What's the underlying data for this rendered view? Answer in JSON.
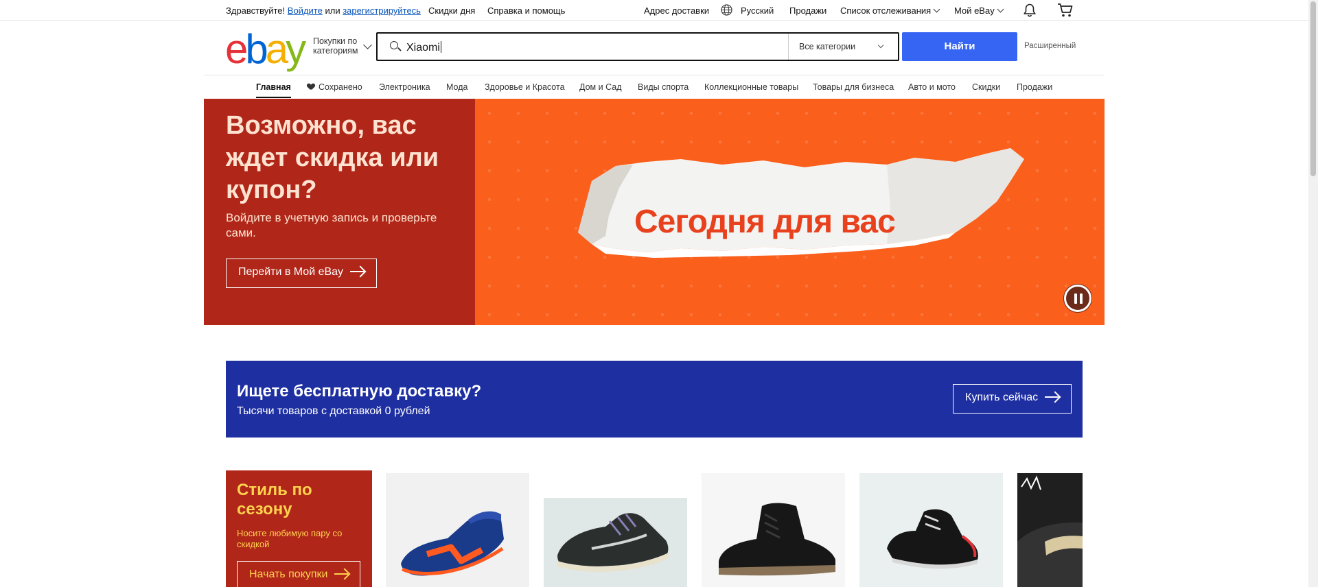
{
  "topbar": {
    "greeting": "Здравствуйте!",
    "signin": "Войдите",
    "or": "или",
    "register": "зарегистрируйтесь",
    "daily_deals": "Скидки дня",
    "help": "Справка и помощь",
    "ship_to": "Адрес доставки",
    "language": "Русский",
    "sell": "Продажи",
    "watchlist": "Список отслеживания",
    "my_ebay": "Мой eBay"
  },
  "header": {
    "logo": {
      "e": "e",
      "b": "b",
      "a": "a",
      "y": "y"
    },
    "shop_by_category_line1": "Покупки по",
    "shop_by_category_line2": "категориям",
    "search_value": "Xiaomi",
    "category_select": "Все категории",
    "search_button": "Найти",
    "advanced": "Расширенный"
  },
  "nav": {
    "items": [
      {
        "label": "Главная",
        "active": true
      },
      {
        "label": "Сохранено"
      },
      {
        "label": "Электроника"
      },
      {
        "label": "Мода"
      },
      {
        "label": "Здоровье и Красота"
      },
      {
        "label": "Дом и Сад"
      },
      {
        "label": "Виды спорта"
      },
      {
        "label": "Коллекционные товары"
      },
      {
        "label": "Товары для бизнеса"
      },
      {
        "label": "Авто и мото"
      },
      {
        "label": "Скидки"
      },
      {
        "label": "Продажи"
      }
    ]
  },
  "hero": {
    "title": "Возможно, вас ждет скидка или купон?",
    "subtitle": "Войдите в учетную запись и проверьте сами.",
    "button": "Перейти в Мой eBay",
    "banner_text": "Сегодня для вас"
  },
  "shipping": {
    "title": "Ищете бесплатную доставку?",
    "subtitle": "Тысячи товаров с доставкой 0 рублей",
    "button": "Купить сейчас"
  },
  "seasonal": {
    "title": "Стиль по сезону",
    "subtitle": "Носите любимую пару со скидкой",
    "button": "Начать покупки"
  },
  "colors": {
    "accent_blue": "#3665f3",
    "hero_red": "#b0271a",
    "hero_orange": "#fa5f1c",
    "shipping_blue": "#1e2fa1",
    "season_yellow": "#ffd24d"
  }
}
